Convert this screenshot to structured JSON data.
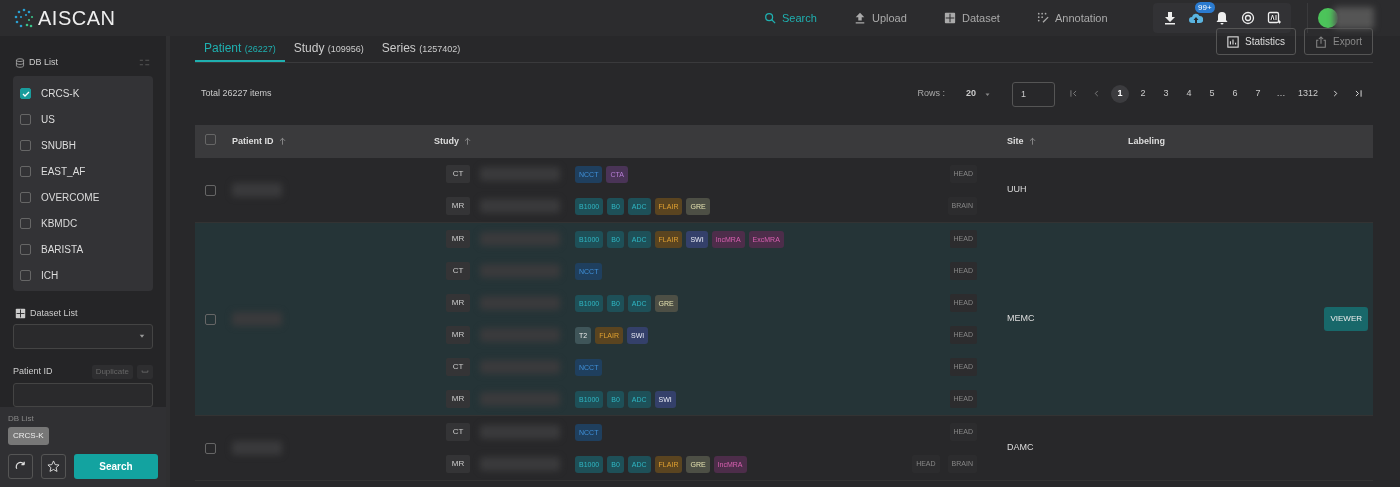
{
  "header": {
    "logo": "AISCAN",
    "nav": [
      {
        "label": "Search",
        "selected": true
      },
      {
        "label": "Upload",
        "selected": false
      },
      {
        "label": "Dataset",
        "selected": false
      },
      {
        "label": "Annotation",
        "selected": false
      }
    ],
    "upload_badge": "99+"
  },
  "sidebar": {
    "db_list": {
      "title": "DB List",
      "items": [
        {
          "label": "CRCS-K",
          "checked": true
        },
        {
          "label": "US",
          "checked": false
        },
        {
          "label": "SNUBH",
          "checked": false
        },
        {
          "label": "EAST_AF",
          "checked": false
        },
        {
          "label": "OVERCOME",
          "checked": false
        },
        {
          "label": "KBMDC",
          "checked": false
        },
        {
          "label": "BARISTA",
          "checked": false
        },
        {
          "label": "ICH",
          "checked": false
        }
      ]
    },
    "dataset_list": {
      "label": "Dataset List"
    },
    "patient_id": {
      "label": "Patient ID",
      "duplicate": "Duplicate"
    },
    "summary": {
      "label": "DB List",
      "chips": [
        "CRCS-K"
      ]
    },
    "search_button": "Search"
  },
  "tabs": [
    {
      "label": "Patient",
      "count": "(26227)",
      "selected": true
    },
    {
      "label": "Study",
      "count": "(109956)",
      "selected": false
    },
    {
      "label": "Series",
      "count": "(1257402)",
      "selected": false
    }
  ],
  "actions": [
    {
      "label": "Statistics",
      "disabled": false
    },
    {
      "label": "Export",
      "disabled": true
    }
  ],
  "total": "Total 26227 items",
  "pagination": {
    "rows_label": "Rows :",
    "rows": "20",
    "page_input": "1",
    "pages": [
      {
        "label": "1",
        "selected": true
      },
      {
        "label": "2",
        "selected": false
      },
      {
        "label": "3",
        "selected": false
      },
      {
        "label": "4",
        "selected": false
      },
      {
        "label": "5",
        "selected": false
      },
      {
        "label": "6",
        "selected": false
      },
      {
        "label": "7",
        "selected": false
      },
      {
        "label": "…",
        "selected": false
      },
      {
        "label": "1312",
        "selected": false
      }
    ]
  },
  "table": {
    "all_checked": false,
    "columns": [
      "Patient ID",
      "Study",
      "Site",
      "Labeling"
    ],
    "rows": [
      {
        "site": "UUH",
        "checked": false,
        "highlighted": false,
        "studies": [
          {
            "modality": "CT",
            "series": [
              {
                "label": "NCCT",
                "kind": "ct"
              },
              {
                "label": "CTA",
                "kind": "angio"
              }
            ],
            "body_parts": [
              "HEAD"
            ]
          },
          {
            "modality": "MR",
            "series": [
              {
                "label": "B1000",
                "kind": "diffusion"
              },
              {
                "label": "B0",
                "kind": "diffusion"
              },
              {
                "label": "ADC",
                "kind": "diffusion"
              },
              {
                "label": "FLAIR",
                "kind": "flair"
              },
              {
                "label": "GRE",
                "kind": "gre"
              }
            ],
            "body_parts": [
              "BRAIN"
            ]
          }
        ]
      },
      {
        "site": "MEMC",
        "checked": false,
        "highlighted": true,
        "viewer": "VIEWER",
        "studies": [
          {
            "modality": "MR",
            "series": [
              {
                "label": "B1000",
                "kind": "diffusion"
              },
              {
                "label": "B0",
                "kind": "diffusion"
              },
              {
                "label": "ADC",
                "kind": "diffusion"
              },
              {
                "label": "FLAIR",
                "kind": "flair"
              },
              {
                "label": "SWI",
                "kind": "swi"
              },
              {
                "label": "IncMRA",
                "kind": "mra"
              },
              {
                "label": "ExcMRA",
                "kind": "mra"
              }
            ],
            "body_parts": [
              "HEAD"
            ]
          },
          {
            "modality": "CT",
            "series": [
              {
                "label": "NCCT",
                "kind": "ct"
              }
            ],
            "body_parts": [
              "HEAD"
            ]
          },
          {
            "modality": "MR",
            "series": [
              {
                "label": "B1000",
                "kind": "diffusion"
              },
              {
                "label": "B0",
                "kind": "diffusion"
              },
              {
                "label": "ADC",
                "kind": "diffusion"
              },
              {
                "label": "GRE",
                "kind": "gre"
              }
            ],
            "body_parts": [
              "HEAD"
            ]
          },
          {
            "modality": "MR",
            "series": [
              {
                "label": "T2",
                "kind": "t2"
              },
              {
                "label": "FLAIR",
                "kind": "flair"
              },
              {
                "label": "SWI",
                "kind": "swi"
              }
            ],
            "body_parts": [
              "HEAD"
            ]
          },
          {
            "modality": "CT",
            "series": [
              {
                "label": "NCCT",
                "kind": "ct"
              }
            ],
            "body_parts": [
              "HEAD"
            ]
          },
          {
            "modality": "MR",
            "series": [
              {
                "label": "B1000",
                "kind": "diffusion"
              },
              {
                "label": "B0",
                "kind": "diffusion"
              },
              {
                "label": "ADC",
                "kind": "diffusion"
              },
              {
                "label": "SWI",
                "kind": "swi"
              }
            ],
            "body_parts": [
              "HEAD"
            ]
          }
        ]
      },
      {
        "site": "DAMC",
        "checked": false,
        "highlighted": false,
        "studies": [
          {
            "modality": "CT",
            "series": [
              {
                "label": "NCCT",
                "kind": "ct"
              }
            ],
            "body_parts": [
              "HEAD"
            ]
          },
          {
            "modality": "MR",
            "series": [
              {
                "label": "B1000",
                "kind": "diffusion"
              },
              {
                "label": "B0",
                "kind": "diffusion"
              },
              {
                "label": "ADC",
                "kind": "diffusion"
              },
              {
                "label": "FLAIR",
                "kind": "flair"
              },
              {
                "label": "GRE",
                "kind": "gre"
              },
              {
                "label": "IncMRA",
                "kind": "mra"
              }
            ],
            "body_parts": [
              "HEAD",
              "BRAIN"
            ]
          }
        ]
      }
    ]
  }
}
